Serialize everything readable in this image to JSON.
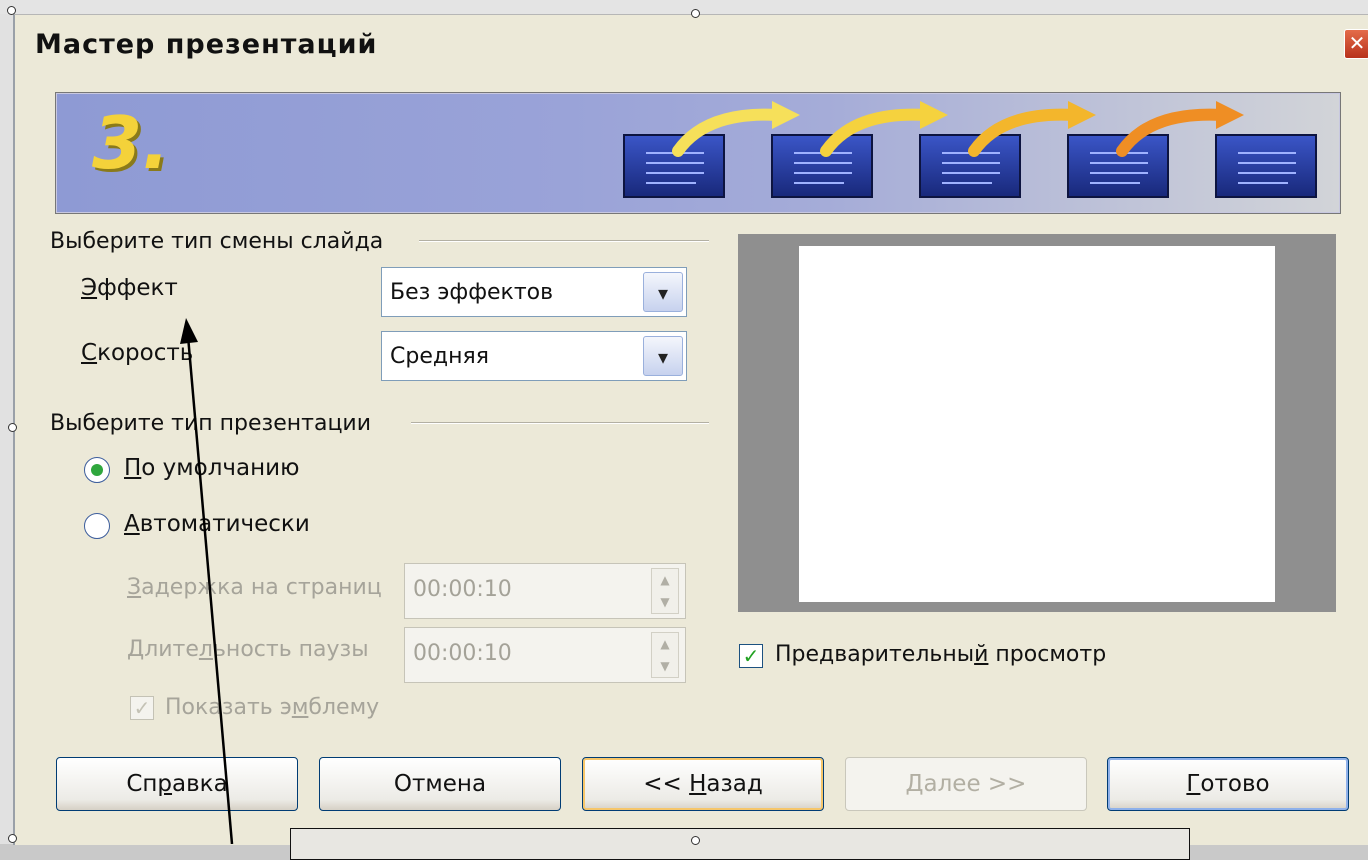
{
  "window": {
    "title": "Мастер презентаций",
    "close_glyph": "✕"
  },
  "banner": {
    "step": "3."
  },
  "transition": {
    "section_label": "Выберите тип смены слайда",
    "effect_label_first": "Э",
    "effect_label_rest": "ффект",
    "effect_value": "Без эффектов",
    "speed_label_first": "С",
    "speed_label_rest": "корость",
    "speed_value": "Средняя"
  },
  "presentation": {
    "section_label": "Выберите тип презентации",
    "default_first": "П",
    "default_rest": "о умолчанию",
    "default_checked": true,
    "auto_first": "А",
    "auto_rest": "втоматически",
    "delay_first": "З",
    "delay_rest": "адержка на страниц",
    "delay_value": "00:00:10",
    "pause_pre": "Длите",
    "pause_u": "л",
    "pause_post": "ьность паузы",
    "pause_value": "00:00:10",
    "logo_pre": "Показать э",
    "logo_u": "м",
    "logo_post": "блему",
    "logo_checked": true
  },
  "preview": {
    "label_pre": "Предварительны",
    "label_u": "й",
    "label_post": " просмотр",
    "checked": true
  },
  "buttons": {
    "help_pre": "Сп",
    "help_u": "р",
    "help_post": "авка",
    "cancel": "Отмена",
    "back_pre": "<< ",
    "back_u": "Н",
    "back_post": "азад",
    "next_u": "Д",
    "next_post": "алее >>",
    "finish_u": "Г",
    "finish_post": "отово"
  },
  "icons": {
    "dropdown": "▾",
    "check": "✓",
    "spin_up": "▲",
    "spin_down": "▼"
  },
  "colors": {
    "dialog_bg": "#ece9d8",
    "banner_start": "#8e9ad4",
    "radio_dot": "#2fa73d",
    "border_blue": "#003c74"
  }
}
